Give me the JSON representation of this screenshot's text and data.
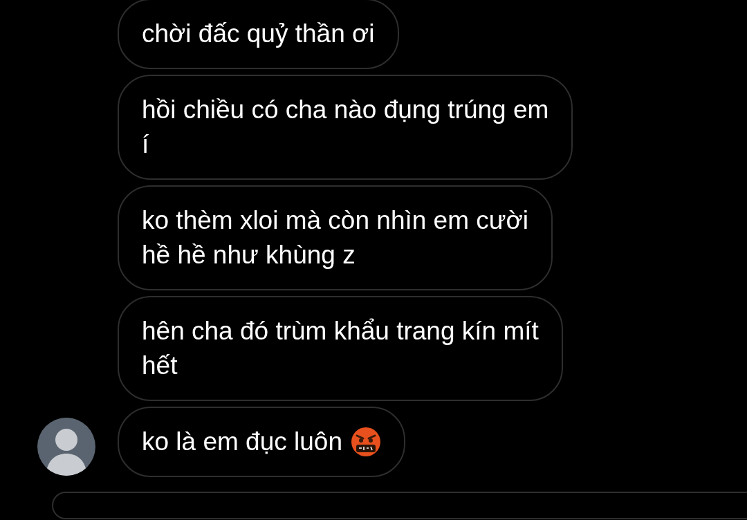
{
  "messages": [
    {
      "text": "chời đấc quỷ thần ơi",
      "emoji": false,
      "avatar": false
    },
    {
      "text": "hồi chiều có cha nào đụng trúng em\ní",
      "emoji": false,
      "avatar": false
    },
    {
      "text": "ko thèm xloi mà còn nhìn em cười\nhề hề như khùng z",
      "emoji": false,
      "avatar": false
    },
    {
      "text": "hên cha đó trùm khẩu trang kín mít\nhết",
      "emoji": false,
      "avatar": false
    },
    {
      "text": "ko là em đục luôn",
      "emoji": true,
      "avatar": true
    }
  ]
}
